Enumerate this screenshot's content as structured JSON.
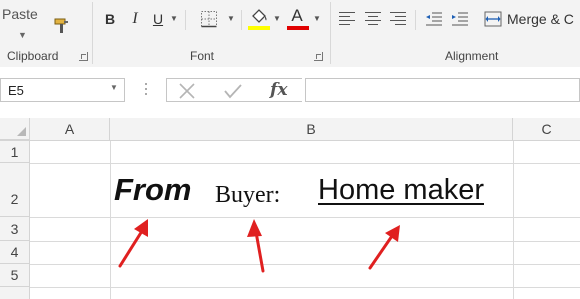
{
  "ribbon": {
    "clipboard": {
      "paste_label": "Paste",
      "group_label": "Clipboard"
    },
    "font": {
      "group_label": "Font",
      "bold_label": "B",
      "italic_label": "I",
      "underline_label": "U",
      "font_color_label": "A",
      "fill_color": "#ffff00",
      "font_color": "#e00000"
    },
    "alignment": {
      "group_label": "Alignment",
      "merge_label": "Merge & C"
    }
  },
  "formula_bar": {
    "name_box": "E5",
    "fx_label": "fx",
    "formula_value": ""
  },
  "grid": {
    "columns": [
      "A",
      "B",
      "C"
    ],
    "rows": [
      "1",
      "2",
      "3",
      "4",
      "5"
    ]
  },
  "cell_b2": {
    "from": "From",
    "buyer": "Buyer:",
    "home_maker": "Home maker"
  },
  "annotation_color": "#e02020"
}
